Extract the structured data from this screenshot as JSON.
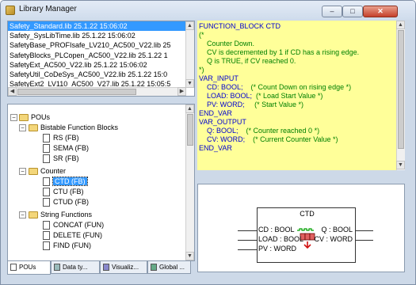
{
  "window": {
    "title": "Library Manager",
    "minimize": "–",
    "maximize": "□",
    "close": "✕"
  },
  "libraries": [
    {
      "label": "Safety_Standard.lib 25.1.22 15:06:02",
      "selected": true
    },
    {
      "label": "Safety_SysLibTime.lib 25.1.22 15:06:02"
    },
    {
      "label": "SafetyBase_PROFIsafe_LV210_AC500_V22.lib 25"
    },
    {
      "label": "SafetyBlocks_PLCopen_AC500_V22.lib 25.1.22 1"
    },
    {
      "label": "SafetyExt_AC500_V22.lib 25.1.22 15:06:02"
    },
    {
      "label": "SafetyUtil_CoDeSys_AC500_V22.lib 25.1.22 15:0"
    },
    {
      "label": "SafetyExt2_LV110_AC500_V27.lib 25.1.22 15:05:5"
    }
  ],
  "code": [
    {
      "text": "FUNCTION_BLOCK CTD",
      "type": "kw"
    },
    {
      "text": "(*",
      "type": "cm"
    },
    {
      "text": "    Counter Down.",
      "type": "cm"
    },
    {
      "text": "    CV is decremented by 1 if CD has a rising edge.",
      "type": "cm"
    },
    {
      "text": "    Q is TRUE, if CV reached 0.",
      "type": "cm"
    },
    {
      "text": "*)",
      "type": "cm"
    },
    {
      "text": "VAR_INPUT",
      "type": "kw"
    },
    {
      "text": "    CD: BOOL;    (* Count Down on rising edge *)",
      "type": "mix"
    },
    {
      "text": "    LOAD: BOOL;  (* Load Start Value *)",
      "type": "mix"
    },
    {
      "text": "    PV: WORD;     (* Start Value *)",
      "type": "mix"
    },
    {
      "text": "END_VAR",
      "type": "kw"
    },
    {
      "text": "VAR_OUTPUT",
      "type": "kw"
    },
    {
      "text": "    Q: BOOL;    (* Counter reached 0 *)",
      "type": "mix"
    },
    {
      "text": "    CV: WORD;    (* Current Counter Value *)",
      "type": "mix"
    },
    {
      "text": "END_VAR",
      "type": "kw"
    }
  ],
  "tree": {
    "root": "POUs",
    "groups": [
      {
        "label": "Bistable Function Blocks",
        "items": [
          "RS (FB)",
          "SEMA (FB)",
          "SR (FB)"
        ]
      },
      {
        "label": "Counter",
        "items": [
          "CTD (FB)",
          "CTU (FB)",
          "CTUD (FB)"
        ],
        "selected_item": "CTD (FB)"
      },
      {
        "label": "String Functions",
        "items": [
          "CONCAT (FUN)",
          "DELETE (FUN)",
          "FIND (FUN)"
        ]
      }
    ]
  },
  "tabs": [
    {
      "label": "POUs",
      "icon": "pou-icon",
      "active": true
    },
    {
      "label": "Data ty...",
      "icon": "data-type-icon"
    },
    {
      "label": "Visualiz...",
      "icon": "visualization-icon"
    },
    {
      "label": "Global ...",
      "icon": "global-icon"
    }
  ],
  "fb": {
    "name": "CTD",
    "inputs": [
      "CD : BOOL",
      "LOAD : BOOL",
      "PV : WORD"
    ],
    "outputs": [
      "Q : BOOL",
      "CV : WORD"
    ]
  },
  "colors": {
    "code_bg": "#ffff99",
    "selection": "#3399ff",
    "keyword": "#0000d0",
    "comment": "#008000"
  }
}
